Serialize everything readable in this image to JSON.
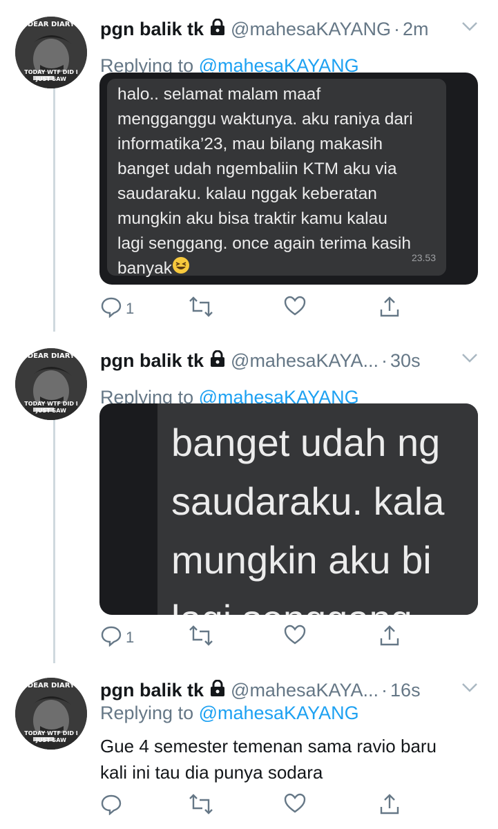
{
  "tweets": [
    {
      "name": "pgn balik tk",
      "handle": "@mahesaKAYANG",
      "time": "2m",
      "reply_prefix": "Replying to ",
      "reply_to": "@mahesaKAYANG",
      "avatar_top": "DEAR DIARY",
      "avatar_bottom": "TODAY WTF DID I JUST SAW",
      "bubble_text": "halo.. selamat malam maaf\nmengganggu waktunya. aku raniya dari\ninformatika’23, mau bilang makasih\nbanget udah ngembaliin KTM aku via\nsaudaraku. kalau nggak keberatan\nmungkin aku bisa traktir kamu kalau\nlagi senggang. once again terima kasih\nbanyak",
      "bubble_time": "23.53",
      "reply_count": "1"
    },
    {
      "name": "pgn balik tk",
      "handle": "@mahesaKAYA...",
      "time": "30s",
      "reply_prefix": "Replying to ",
      "reply_to": "@mahesaKAYANG",
      "avatar_top": "DEAR DIARY",
      "avatar_bottom": "TODAY WTF DID I JUST SAW",
      "zoom_text": "banget udah ng\nsaudaraku. kala\nmungkin aku bi\nlagi senggang",
      "reply_count": "1"
    },
    {
      "name": "pgn balik tk",
      "handle": "@mahesaKAYA...",
      "time": "16s",
      "reply_prefix": "Replying to ",
      "reply_to": "@mahesaKAYANG",
      "avatar_top": "DEAR DIARY",
      "avatar_bottom": "TODAY WTF DID I JUST SAW",
      "text": "Gue 4 semester temenan sama ravio baru\nkali ini tau dia punya sodara",
      "reply_count": ""
    }
  ],
  "icons": {
    "lock": "lock-icon",
    "chevron": "chevron-down-icon",
    "reply": "reply-icon",
    "retweet": "retweet-icon",
    "like": "heart-icon",
    "share": "share-icon",
    "emoji": "grinning-squinting-face"
  },
  "colors": {
    "secondary_text": "#657786",
    "mention": "#1da1f2",
    "thread_line": "#cfd9de"
  }
}
